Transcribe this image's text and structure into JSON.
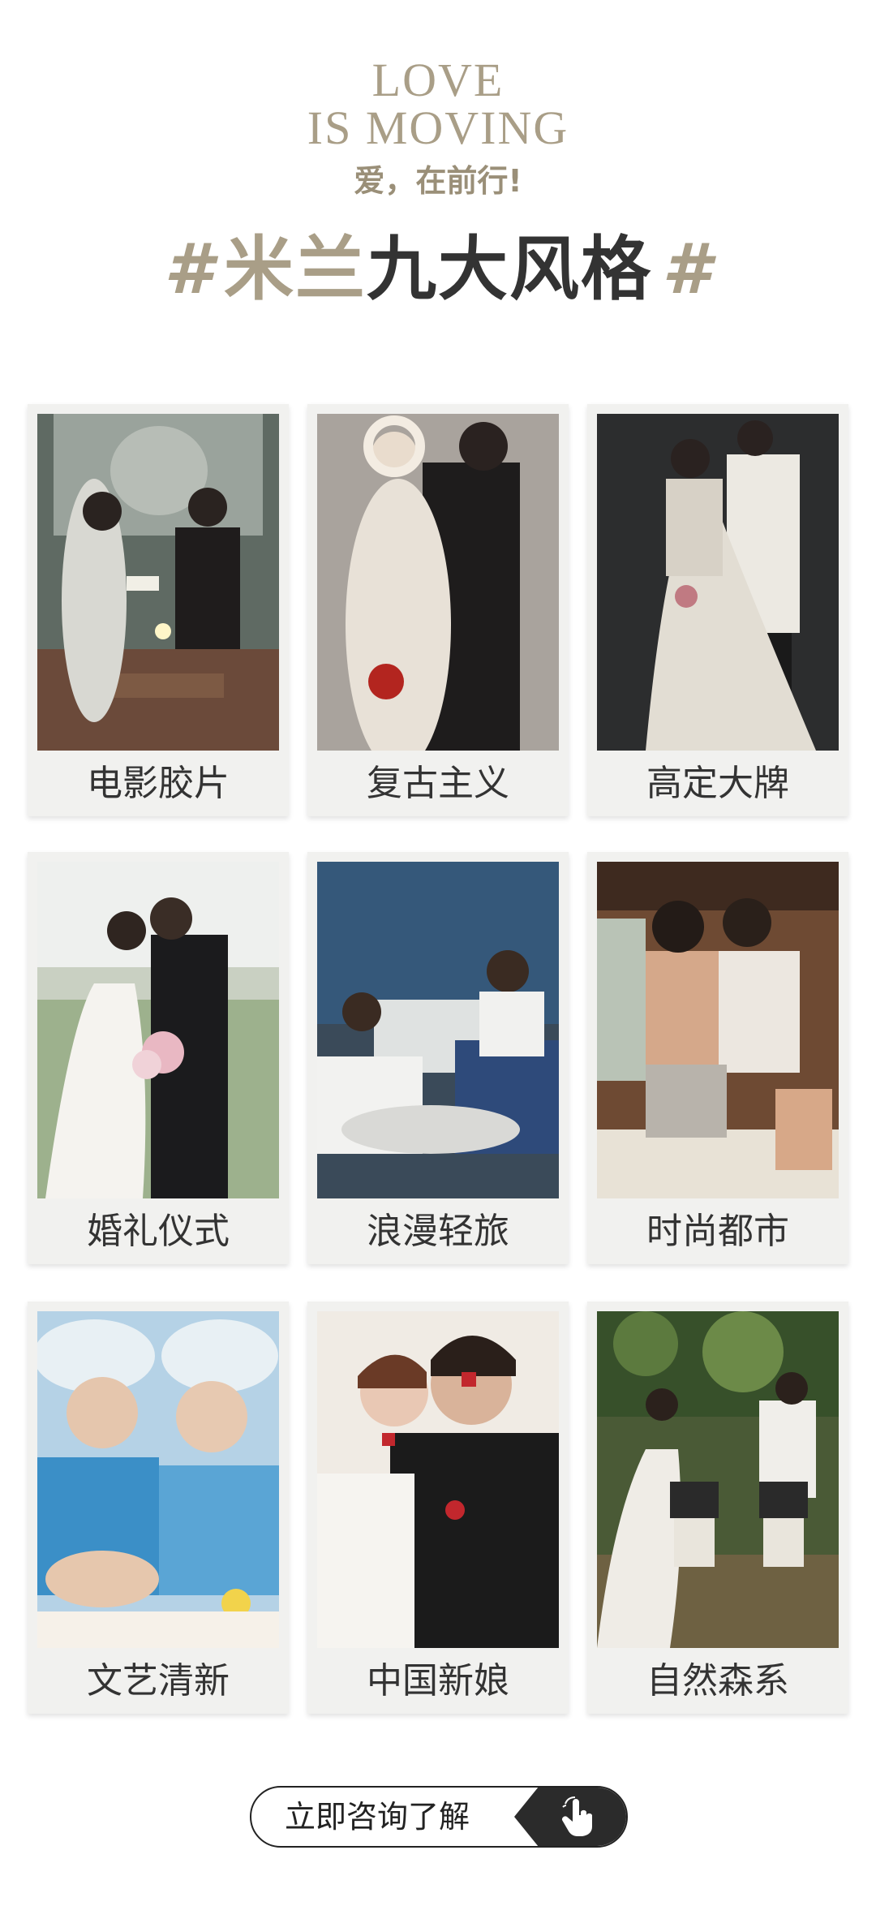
{
  "brand": {
    "line1": "LOVE",
    "line2": "IS MOVING",
    "slogan": "爱，在前行!"
  },
  "title": {
    "hash_left": "#",
    "accent": "米兰",
    "main": "九大风格",
    "hash_right": "#"
  },
  "styles": [
    {
      "label": "电影胶片",
      "icon": "film-photo"
    },
    {
      "label": "复古主义",
      "icon": "retro-photo"
    },
    {
      "label": "高定大牌",
      "icon": "couture-photo"
    },
    {
      "label": "婚礼仪式",
      "icon": "ceremony-photo"
    },
    {
      "label": "浪漫轻旅",
      "icon": "travel-photo"
    },
    {
      "label": "时尚都市",
      "icon": "urban-photo"
    },
    {
      "label": "文艺清新",
      "icon": "fresh-photo"
    },
    {
      "label": "中国新娘",
      "icon": "chinese-bride-photo"
    },
    {
      "label": "自然森系",
      "icon": "forest-photo"
    }
  ],
  "cta": {
    "label": "立即咨询了解",
    "icon": "tap-hand-icon"
  },
  "colors": {
    "accent": "#a99e87",
    "dark": "#333333",
    "card_bg": "#f1f1ef"
  }
}
